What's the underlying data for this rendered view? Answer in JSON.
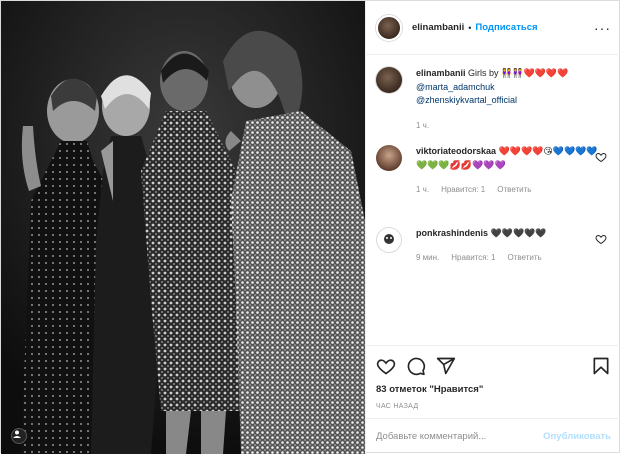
{
  "header": {
    "username": "elinambanii",
    "separator": "•",
    "follow_label": "Подписаться",
    "more_label": "···"
  },
  "caption": {
    "username": "elinambanii",
    "text": "Girls by",
    "emoji": "👭👭❤️❤️❤️❤️",
    "mention1": "@marta_adamchuk",
    "mention2": "@zhenskiykvartal_official",
    "time": "1 ч."
  },
  "comments": [
    {
      "username": "viktoriateodorskaa",
      "text": "❤️❤️❤️❤️😘💙💙💙💙💚💚💚💋💋💜💜💜",
      "time": "1 ч.",
      "likes": "Нравится: 1",
      "reply": "Ответить"
    },
    {
      "username": "ponkrashindenis",
      "text": "🖤🖤🖤🖤🖤",
      "time": "9 мин.",
      "likes": "Нравится: 1",
      "reply": "Ответить"
    }
  ],
  "actions": {
    "likes_text": "83 отметок \"Нравится\"",
    "time_ago": "ЧАС НАЗАД"
  },
  "add_comment": {
    "placeholder": "Добавьте комментарий...",
    "publish_label": "Опубликовать"
  },
  "colors": {
    "accent": "#0095f6",
    "link": "#00376b",
    "muted": "#8e8e8e",
    "publish_disabled": "#b2dffc"
  },
  "icons": [
    "like-icon",
    "comment-icon",
    "share-icon",
    "save-icon",
    "more-icon",
    "tag-user-icon"
  ]
}
